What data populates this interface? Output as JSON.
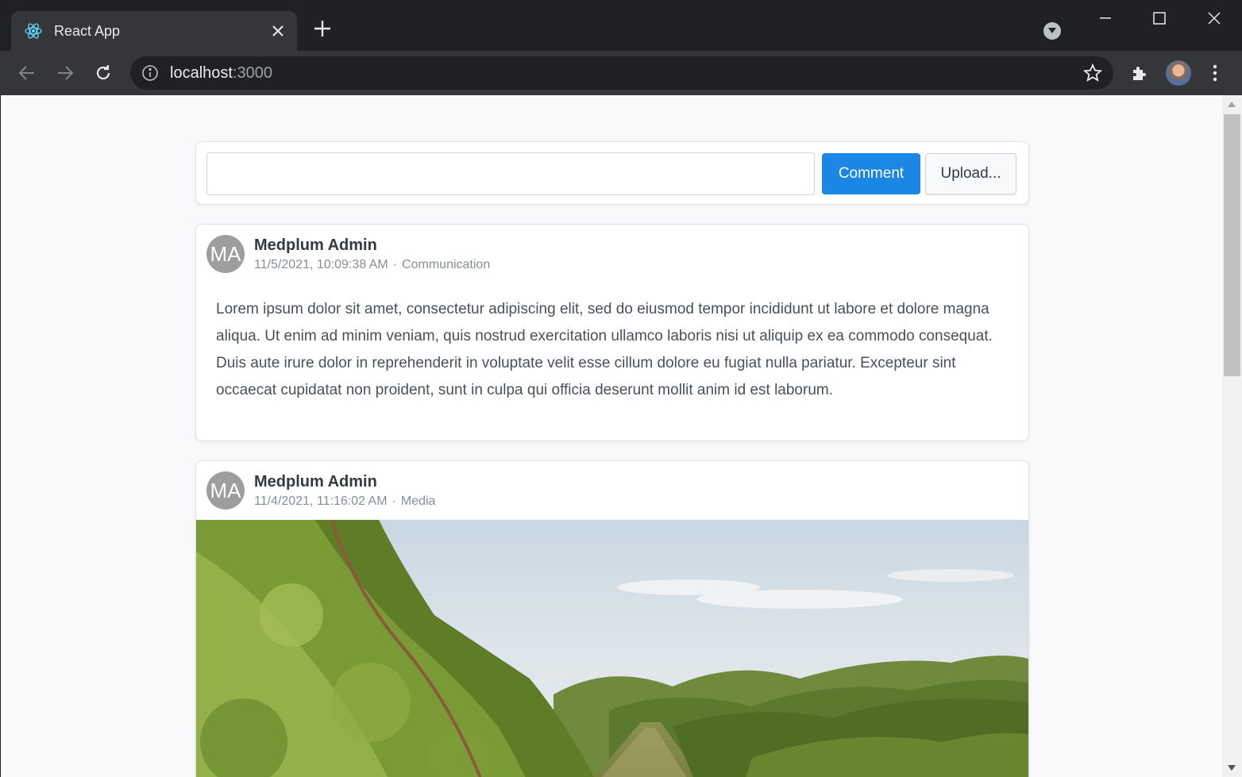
{
  "browser": {
    "tab_title": "React App",
    "url_host": "localhost",
    "url_port": ":3000"
  },
  "composer": {
    "input_value": "",
    "comment_label": "Comment",
    "upload_label": "Upload..."
  },
  "posts": [
    {
      "avatar_initials": "MA",
      "author": "Medplum Admin",
      "timestamp": "11/5/2021, 10:09:38 AM",
      "separator": "·",
      "resource_type": "Communication",
      "body": "Lorem ipsum dolor sit amet, consectetur adipiscing elit, sed do eiusmod tempor incididunt ut labore et dolore magna aliqua. Ut enim ad minim veniam, quis nostrud exercitation ullamco laboris nisi ut aliquip ex ea commodo consequat. Duis aute irure dolor in reprehenderit in voluptate velit esse cillum dolore eu fugiat nulla pariatur. Excepteur sint occaecat cupidatat non proident, sunt in culpa qui officia deserunt mollit anim id est laborum."
    },
    {
      "avatar_initials": "MA",
      "author": "Medplum Admin",
      "timestamp": "11/4/2021, 11:16:02 AM",
      "separator": "·",
      "resource_type": "Media"
    }
  ]
}
